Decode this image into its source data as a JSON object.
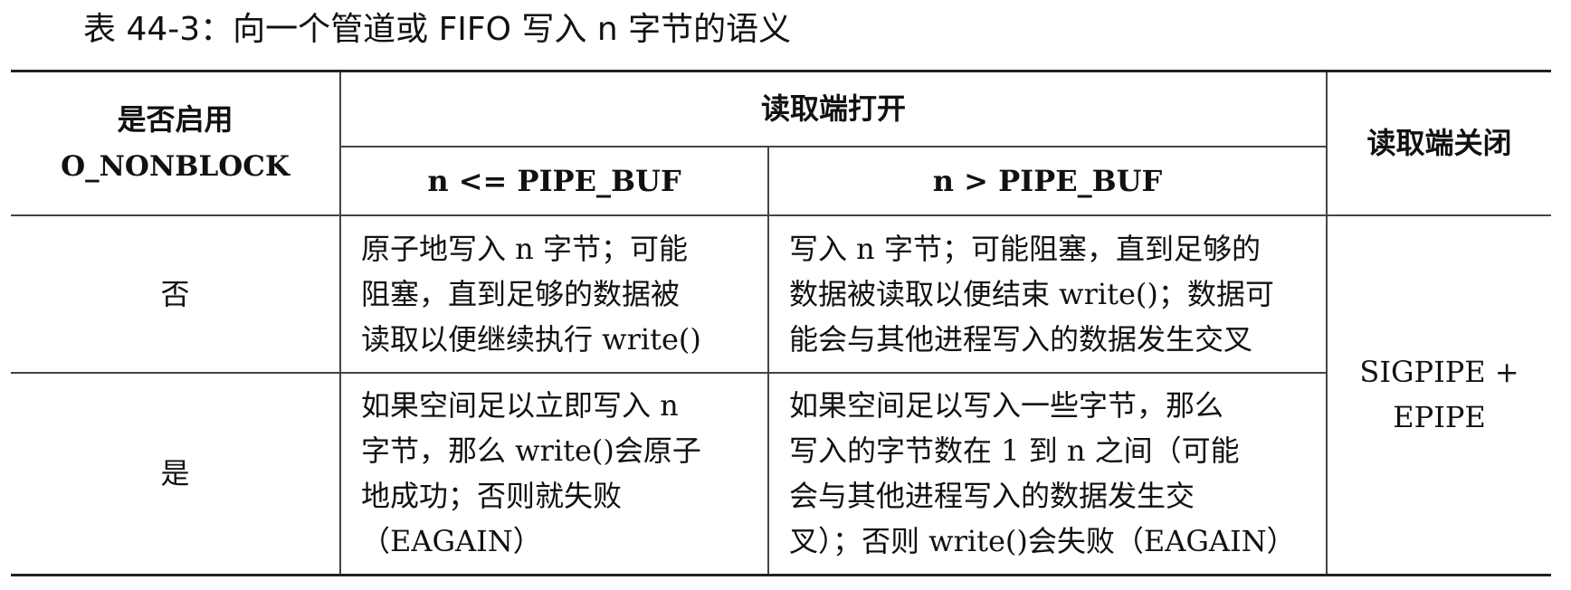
{
  "caption": "表 44-3：向一个管道或 FIFO 写入 n 字节的语义",
  "header": {
    "nonblock_line1": "是否启用",
    "nonblock_line2": "O_NONBLOCK",
    "reader_open": "读取端打开",
    "small_write": "n <= PIPE_BUF",
    "large_write": "n > PIPE_BUF",
    "reader_closed": "读取端关闭"
  },
  "rows": [
    {
      "nonblock": "否",
      "small_lines": [
        "原子地写入 n 字节；可能",
        "阻塞，直到足够的数据被",
        "读取以便继续执行 write()"
      ],
      "large_lines": [
        "写入 n 字节；可能阻塞，直到足够的",
        "数据被读取以便结束 write()；数据可",
        "能会与其他进程写入的数据发生交叉"
      ]
    },
    {
      "nonblock": "是",
      "small_lines": [
        "如果空间足以立即写入 n",
        "字节，那么 write()会原子",
        "地成功；否则就失败",
        "（EAGAIN）"
      ],
      "large_lines": [
        "如果空间足以写入一些字节，那么",
        "写入的字节数在 1 到 n 之间（可能",
        "会与其他进程写入的数据发生交",
        "叉）；否则 write()会失败（EAGAIN）"
      ]
    }
  ],
  "closed_lines": [
    "SIGPIPE +",
    "EPIPE"
  ]
}
